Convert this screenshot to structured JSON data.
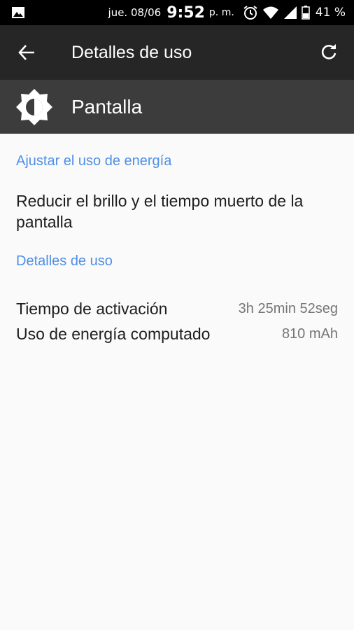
{
  "status_bar": {
    "date": "jue. 08/06",
    "time": "9:52",
    "ampm": "p. m.",
    "battery_percent": "41 %",
    "icons": [
      "image-icon",
      "alarm-icon",
      "wifi-icon",
      "signal-icon",
      "battery-icon"
    ]
  },
  "app_bar": {
    "title": "Detalles de uso",
    "back_icon": "arrow-back-icon",
    "refresh_icon": "refresh-icon"
  },
  "header": {
    "icon": "brightness-icon",
    "title": "Pantalla"
  },
  "sections": {
    "adjust": {
      "header": "Ajustar el uso de energía",
      "item": "Reducir el brillo y el tiempo muerto de la pantalla"
    },
    "details": {
      "header": "Detalles de uso",
      "rows": [
        {
          "label": "Tiempo de activación",
          "value": "3h 25min 52seg"
        },
        {
          "label": "Uso de energía computado",
          "value": "810 mAh"
        }
      ]
    }
  },
  "colors": {
    "status_bar": "#000000",
    "app_bar": "#262626",
    "header_band": "#3c3c3c",
    "accent": "#4f8fe6",
    "background": "#fafafa"
  }
}
